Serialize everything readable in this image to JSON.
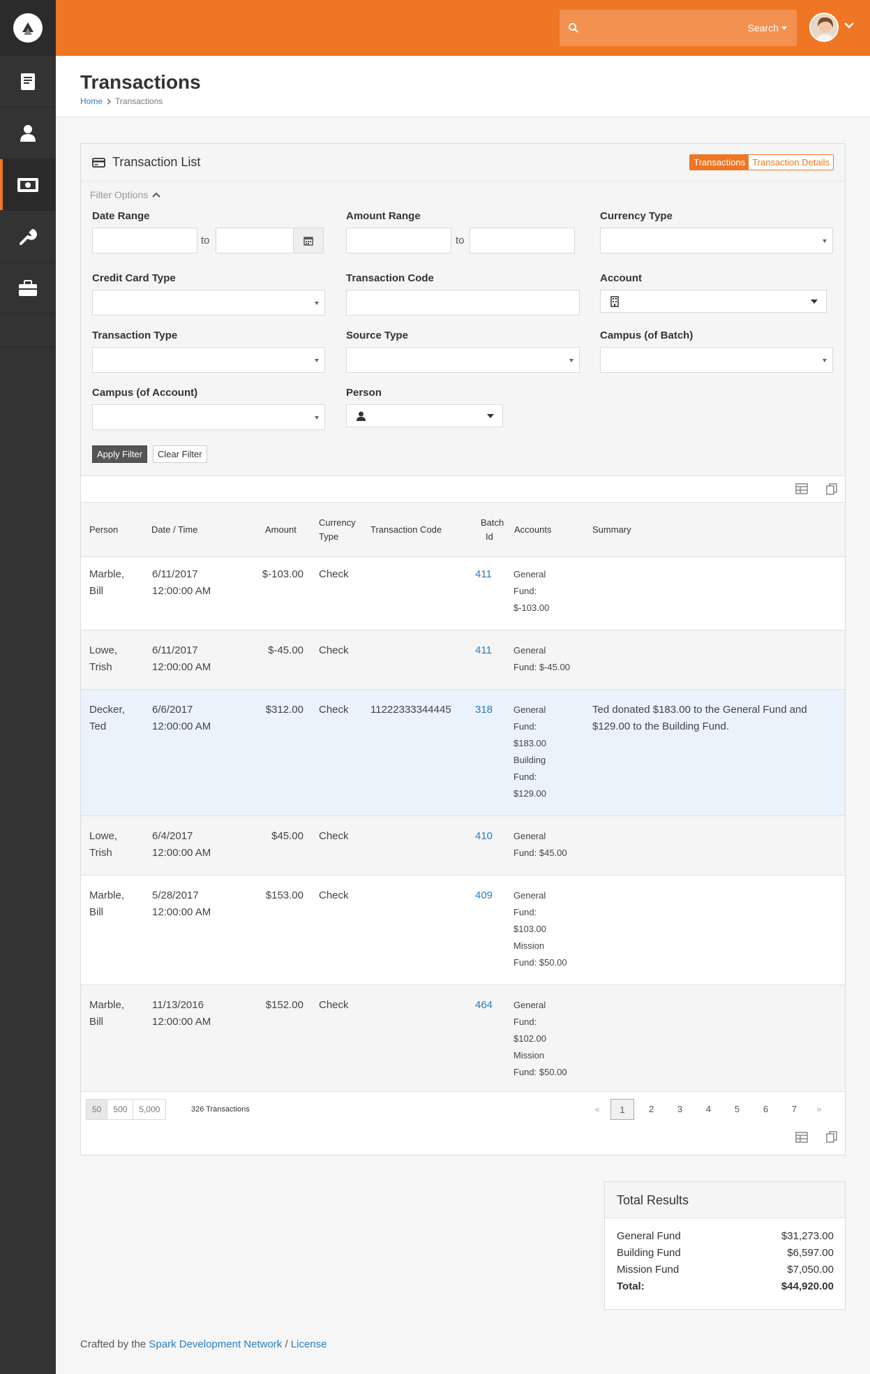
{
  "topbar": {
    "search_placeholder": "",
    "search_label": "Search"
  },
  "sidebar": {
    "items": [
      {
        "icon": "book-icon"
      },
      {
        "icon": "person-icon"
      },
      {
        "icon": "money-icon",
        "active": true
      },
      {
        "icon": "wrench-icon"
      },
      {
        "icon": "briefcase-icon"
      }
    ]
  },
  "page": {
    "title": "Transactions",
    "breadcrumb": [
      "Home",
      "Transactions"
    ]
  },
  "panel": {
    "title": "Transaction List",
    "toggle": [
      "Transactions",
      "Transaction Details"
    ],
    "toggle_active": "Transactions"
  },
  "filters": {
    "toggle_label": "Filter Options",
    "date_range": "Date Range",
    "to1": "to",
    "amount_range": "Amount Range",
    "to2": "to",
    "currency_type": "Currency Type",
    "credit_card_type": "Credit Card Type",
    "transaction_code": "Transaction Code",
    "account": "Account",
    "transaction_type": "Transaction Type",
    "source_type": "Source Type",
    "campus_batch": "Campus (of Batch)",
    "campus_account": "Campus (of Account)",
    "person": "Person",
    "apply": "Apply Filter",
    "clear": "Clear Filter"
  },
  "grid": {
    "headers": {
      "person": "Person",
      "datetime": "Date / Time",
      "amount": "Amount",
      "currency1": "Currency",
      "currency2": "Type",
      "transaction_code": "Transaction Code",
      "batch1": "Batch",
      "batch2": "Id",
      "accounts": "Accounts",
      "summary": "Summary"
    },
    "rows": [
      {
        "p1": "Marble,",
        "p2": "Bill",
        "d1": "6/11/2017",
        "d2": "12:00:00 AM",
        "amount": "$-103.00",
        "currency": "Check",
        "code": "",
        "batch": "411",
        "acc": [
          "General",
          "Fund:",
          "$-103.00"
        ],
        "summary": [
          "",
          ""
        ]
      },
      {
        "p1": "Lowe,",
        "p2": "Trish",
        "d1": "6/11/2017",
        "d2": "12:00:00 AM",
        "amount": "$-45.00",
        "currency": "Check",
        "code": "",
        "batch": "411",
        "acc": [
          "General",
          "Fund: $-45.00"
        ],
        "summary": [
          "",
          ""
        ]
      },
      {
        "p1": "Decker,",
        "p2": "Ted",
        "d1": "6/6/2017",
        "d2": "12:00:00 AM",
        "amount": "$312.00",
        "currency": "Check",
        "code": "11222333344445",
        "batch": "318",
        "acc": [
          "General",
          "Fund:",
          "$183.00",
          "Building",
          "Fund:",
          "$129.00"
        ],
        "summary": [
          "Ted donated $183.00 to the General Fund and",
          "$129.00 to the Building Fund."
        ]
      },
      {
        "p1": "Lowe,",
        "p2": "Trish",
        "d1": "6/4/2017",
        "d2": "12:00:00 AM",
        "amount": "$45.00",
        "currency": "Check",
        "code": "",
        "batch": "410",
        "acc": [
          "General",
          "Fund: $45.00"
        ],
        "summary": [
          "",
          ""
        ]
      },
      {
        "p1": "Marble,",
        "p2": "Bill",
        "d1": "5/28/2017",
        "d2": "12:00:00 AM",
        "amount": "$153.00",
        "currency": "Check",
        "code": "",
        "batch": "409",
        "acc": [
          "General",
          "Fund:",
          "$103.00",
          "Mission",
          "Fund: $50.00"
        ],
        "summary": [
          "",
          ""
        ]
      },
      {
        "p1": "Marble,",
        "p2": "Bill",
        "d1": "11/13/2016",
        "d2": "12:00:00 AM",
        "amount": "$152.00",
        "currency": "Check",
        "code": "",
        "batch": "464",
        "acc": [
          "General",
          "Fund:",
          "$102.00",
          "Mission",
          "Fund: $50.00"
        ],
        "summary": [
          "",
          ""
        ]
      }
    ],
    "page_sizes": [
      "50",
      "500",
      "5,000"
    ],
    "count_label": "326 Transactions",
    "pages": [
      "«",
      "1",
      "2",
      "3",
      "4",
      "5",
      "6",
      "7",
      "»"
    ]
  },
  "totals": {
    "title": "Total Results",
    "rows": [
      {
        "label": "General Fund",
        "value": "$31,273.00"
      },
      {
        "label": "Building Fund",
        "value": "$6,597.00"
      },
      {
        "label": "Mission Fund",
        "value": "$7,050.00"
      }
    ],
    "total_label": "Total:",
    "total_value": "$44,920.00"
  },
  "footer": {
    "prefix": "Crafted by the",
    "link1": "Spark Development Network",
    "sep": "/",
    "link2": "License"
  },
  "colors": {
    "accent": "#ee7624",
    "sidebar": "#333333",
    "link": "#2a7dc1"
  }
}
